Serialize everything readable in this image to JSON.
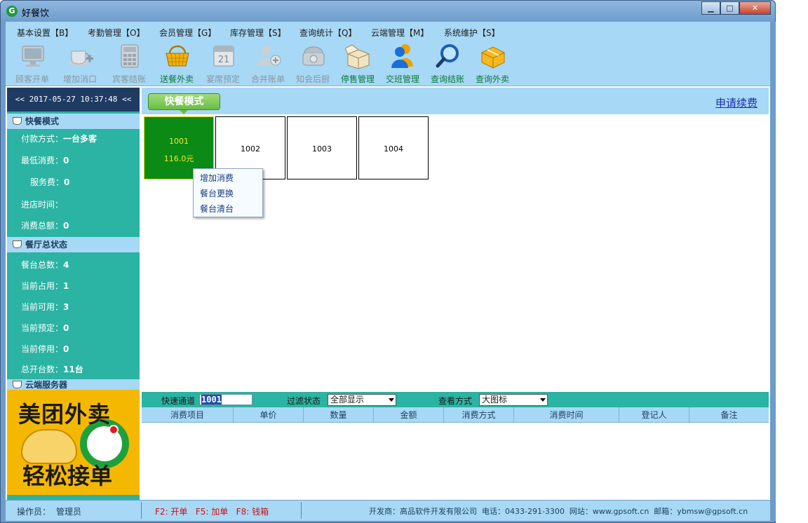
{
  "window": {
    "title": "好餐饮",
    "logo_glyph": "G",
    "min_glyph": "▁",
    "max_glyph": "□",
    "close_glyph": "✕"
  },
  "menu": [
    "基本设置【B】",
    "考勤管理【O】",
    "会员管理【G】",
    "库存管理【S】",
    "查询统计【Q】",
    "云端管理【M】",
    "系统维护【S】"
  ],
  "toolbar": [
    {
      "label": "顾客开单",
      "icon": "monitor-icon",
      "enabled": false
    },
    {
      "label": "增加消口",
      "icon": "cup-add-icon",
      "enabled": false
    },
    {
      "label": "宾客结账",
      "icon": "calculator-icon",
      "enabled": false
    },
    {
      "label": "送餐外卖",
      "icon": "basket-icon",
      "enabled": true
    },
    {
      "label": "宴席预定",
      "icon": "calendar-icon",
      "enabled": false
    },
    {
      "label": "合并账单",
      "icon": "user-add-icon",
      "enabled": false
    },
    {
      "label": "知会后厨",
      "icon": "phone-icon",
      "enabled": false
    },
    {
      "label": "停售管理",
      "icon": "box-icon",
      "enabled": true
    },
    {
      "label": "交班管理",
      "icon": "users-icon",
      "enabled": true
    },
    {
      "label": "查询结账",
      "icon": "magnifier-icon",
      "enabled": true
    },
    {
      "label": "查询外卖",
      "icon": "parcel-icon",
      "enabled": true
    }
  ],
  "sidebar": {
    "datetime": "<< 2017-05-27 10:37:48 <<",
    "section1": {
      "title": "快餐模式",
      "rows": [
        {
          "label": "付款方式：",
          "value": "一台多客"
        },
        {
          "label": "最低消费：",
          "value": "0"
        },
        {
          "label": "服务费：",
          "value": "0"
        },
        {
          "label": "进店时间：",
          "value": ""
        },
        {
          "label": "消费总额：",
          "value": "0"
        }
      ]
    },
    "section2": {
      "title": "餐厅总状态",
      "rows": [
        {
          "label": "餐台总数：",
          "value": "4"
        },
        {
          "label": "当前占用：",
          "value": "1"
        },
        {
          "label": "当前可用：",
          "value": "3"
        },
        {
          "label": "当前预定：",
          "value": "0"
        },
        {
          "label": "当前停用：",
          "value": "0"
        },
        {
          "label": "总开台数：",
          "value": "11台"
        }
      ]
    },
    "section3": {
      "title": "云端服务器"
    },
    "ad": {
      "line1": "美团外卖",
      "line2": "轻松接单"
    }
  },
  "main": {
    "mode_tab": "快餐模式",
    "renew_link": "申请续费",
    "tables": [
      {
        "name": "1001",
        "amount": "116.0元",
        "busy": true
      },
      {
        "name": "1002",
        "amount": "",
        "busy": false
      },
      {
        "name": "1003",
        "amount": "",
        "busy": false
      },
      {
        "name": "1004",
        "amount": "",
        "busy": false
      }
    ],
    "context_menu": [
      "增加消费",
      "餐台更换",
      "餐台清台"
    ],
    "filter": {
      "quick_label": "快速通道",
      "quick_value": "1001",
      "status_label": "过滤状态",
      "status_value": "全部显示",
      "view_label": "查看方式",
      "view_value": "大图标"
    },
    "grid_columns": [
      "消费项目",
      "单价",
      "数量",
      "金额",
      "消费方式",
      "消费时间",
      "登记人",
      "备注"
    ]
  },
  "status": {
    "operator_label": "操作员：",
    "operator": "管理员",
    "shortcuts": "F2: 开单   F5: 加单   F8: 钱箱",
    "developer": "开发商：高品软件开发有限公司  电话：0433-291-3300  网站：www.gpsoft.cn  邮箱：ybmsw@gpsoft.cn"
  },
  "colors": {
    "teal": "#2bb3a3",
    "light_blue": "#a7d8f5",
    "busy_table": "#0b8a16",
    "navy": "#1f3b63"
  }
}
